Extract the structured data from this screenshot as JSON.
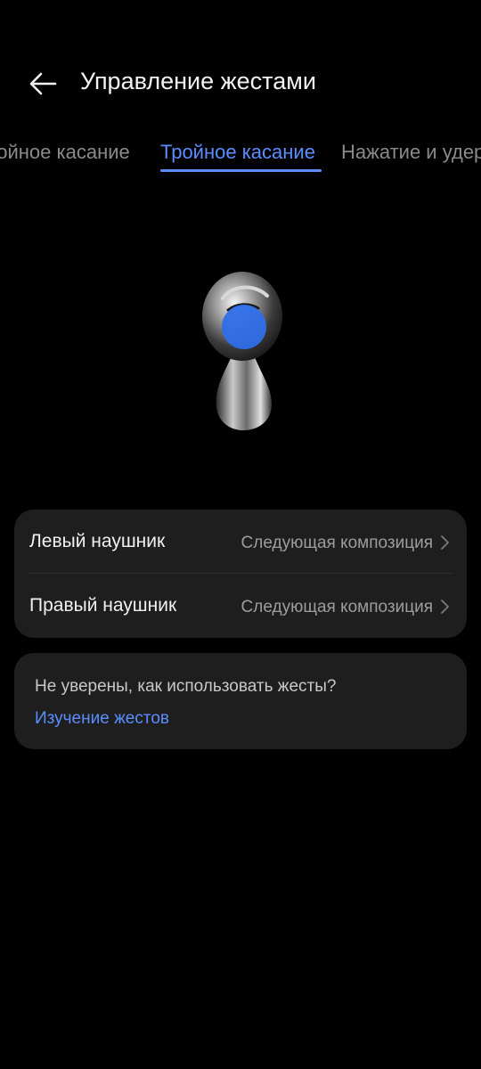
{
  "header": {
    "title": "Управление жестами",
    "back_icon": "arrow-left-icon"
  },
  "tabs": {
    "items": [
      {
        "label": "ройное касание"
      },
      {
        "label": "Тройное касание"
      },
      {
        "label": "Нажатие и удерж"
      }
    ],
    "active_index": 1
  },
  "illustration": {
    "icon": "earbud-image",
    "highlight_color": "#2f6ee8"
  },
  "settings": {
    "rows": [
      {
        "label": "Левый наушник",
        "value": "Следующая композиция"
      },
      {
        "label": "Правый наушник",
        "value": "Следующая композиция"
      }
    ],
    "chevron_icon": "chevron-right-icon"
  },
  "help": {
    "text": "Не уверены, как использовать жесты?",
    "link": "Изучение жестов"
  },
  "colors": {
    "background": "#000000",
    "card": "#1e1e1e",
    "accent": "#5c8dff"
  }
}
